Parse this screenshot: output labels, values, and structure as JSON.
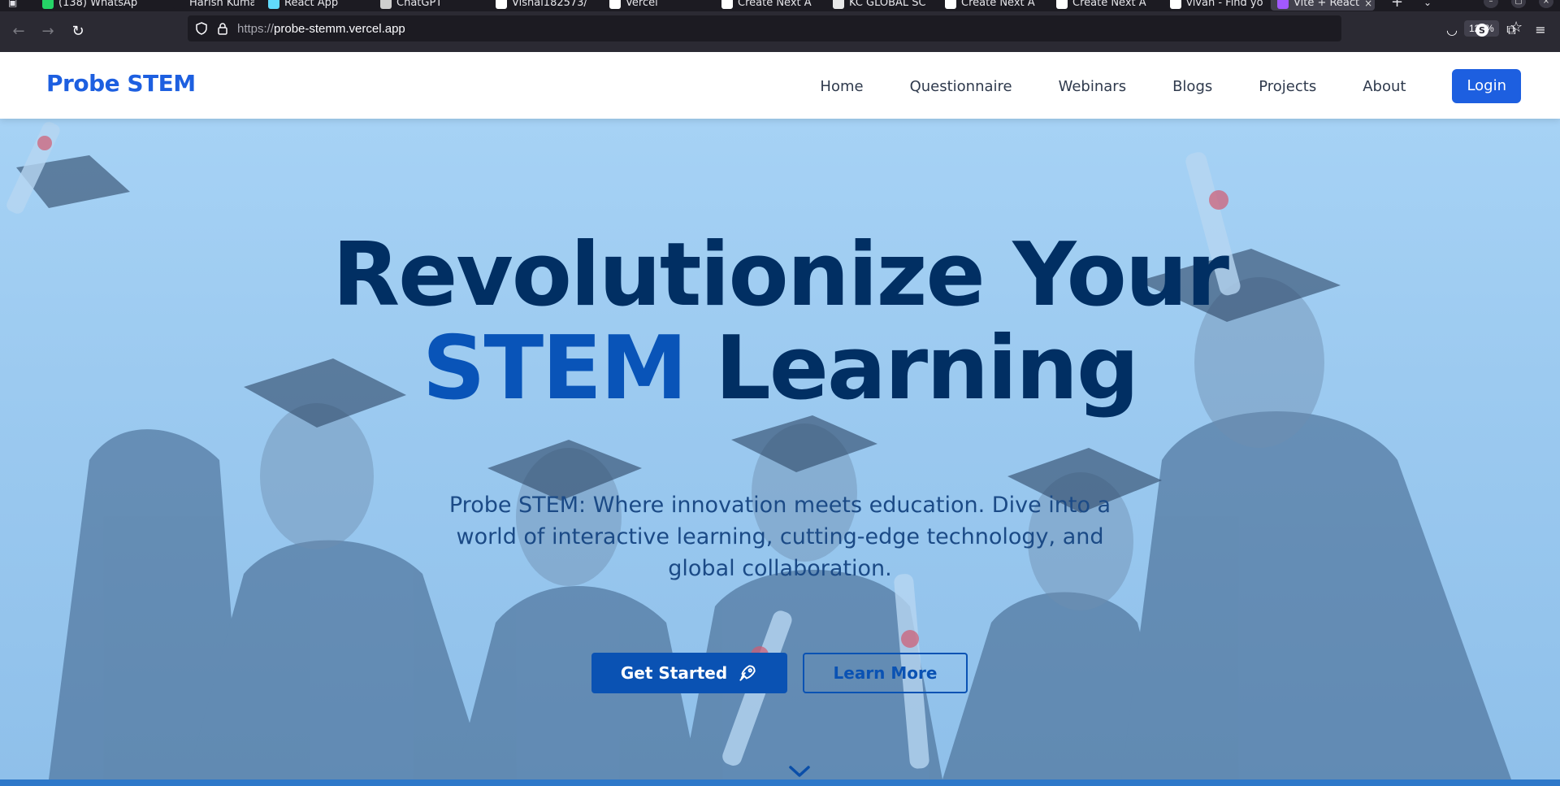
{
  "browser": {
    "tabs": [
      {
        "label": "(138) WhatsAp",
        "favicon": "whatsapp-icon",
        "color": "#25d366"
      },
      {
        "label": "Harish Kumar",
        "favicon": "blank-icon",
        "color": "#1c1b22"
      },
      {
        "label": "React App",
        "favicon": "react-icon",
        "color": "#61dafb"
      },
      {
        "label": "ChatGPT",
        "favicon": "chatgpt-icon",
        "color": "#cfcfcf"
      },
      {
        "label": "Vishal182573/",
        "favicon": "github-icon",
        "color": "#ffffff"
      },
      {
        "label": "Vercel",
        "favicon": "vercel-icon",
        "color": "#ffffff"
      },
      {
        "label": "Create Next A",
        "favicon": "vercel-icon",
        "color": "#ffffff"
      },
      {
        "label": "KC GLOBAL SC",
        "favicon": "doc-icon",
        "color": "#e8e8e8"
      },
      {
        "label": "Create Next A",
        "favicon": "vercel-icon",
        "color": "#ffffff"
      },
      {
        "label": "Create Next A",
        "favicon": "vercel-icon",
        "color": "#ffffff"
      },
      {
        "label": "vivan - Find yo",
        "favicon": "vercel-icon",
        "color": "#ffffff"
      },
      {
        "label": "Vite + React",
        "favicon": "vite-icon",
        "color": "#a259ff",
        "active": true
      }
    ],
    "url_protocol": "https://",
    "url_host": "probe-stemm.vercel.app",
    "zoom": "120%"
  },
  "site": {
    "logo": "Probe STEM",
    "nav": [
      "Home",
      "Questionnaire",
      "Webinars",
      "Blogs",
      "Projects",
      "About"
    ],
    "login": "Login",
    "brand_color": "#1d5fe0"
  },
  "hero": {
    "title_line1": "Revolutionize Your",
    "title_accent": "STEM",
    "title_line2_rest": " Learning",
    "subtitle": "Probe STEM: Where innovation meets education. Dive into a world of interactive learning, cutting-edge technology, and global collaboration.",
    "primary_cta": "Get Started",
    "secondary_cta": "Learn More",
    "title_color": "#012f63",
    "accent_color": "#0954b8"
  }
}
